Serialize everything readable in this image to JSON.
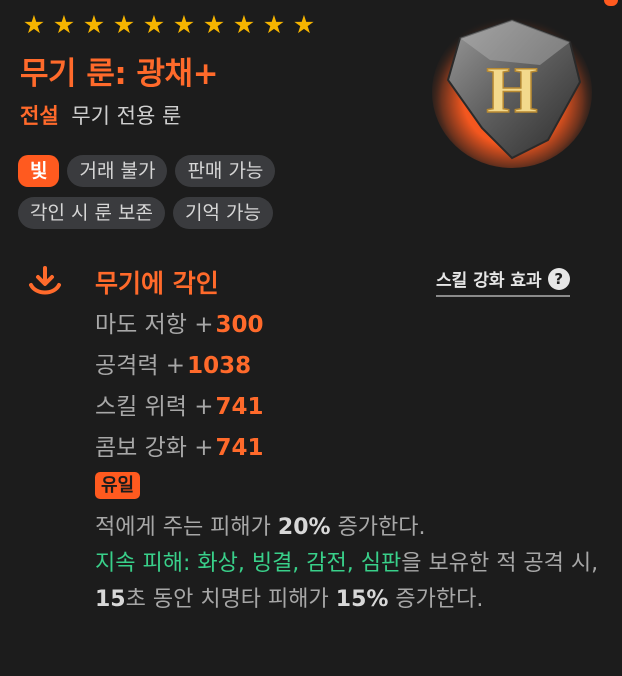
{
  "stars": {
    "count": 10,
    "symbol": "★",
    "color": "#f5b400"
  },
  "item": {
    "name": "무기 룬: 광채+",
    "rarity": "전설",
    "type": "무기 전용 룬",
    "rune_glyph": "H",
    "accent_color": "#ff6a2b"
  },
  "tags": [
    {
      "label": "빛",
      "highlight": true
    },
    {
      "label": "거래 불가"
    },
    {
      "label": "판매 가능"
    },
    {
      "label": "각인 시 룬 보존"
    },
    {
      "label": "기억 가능"
    }
  ],
  "engrave": {
    "icon": "download-arrow-icon",
    "title": "무기에 각인",
    "skill_link": "스킬 강화 효과",
    "help_icon": "question-mark-icon"
  },
  "stats": [
    {
      "label": "마도 저항 +",
      "value": "300"
    },
    {
      "label": "공격력 +",
      "value": "1038"
    },
    {
      "label": "스킬 위력 +",
      "value": "741"
    },
    {
      "label": "콤보 강화 +",
      "value": "741"
    }
  ],
  "unique": {
    "badge": "유일",
    "line1_pre": "적에게 주는 피해가 ",
    "line1_val": "20%",
    "line1_post": " 증가한다.",
    "green_text": "지속 피해: 화상, 빙결, 감전, 심판",
    "line2_post": "을 보유한 적 공격 시, ",
    "duration": "15",
    "line3_mid": "초 동안 치명타 피해가 ",
    "crit_val": "15%",
    "line3_post": " 증가한다."
  }
}
